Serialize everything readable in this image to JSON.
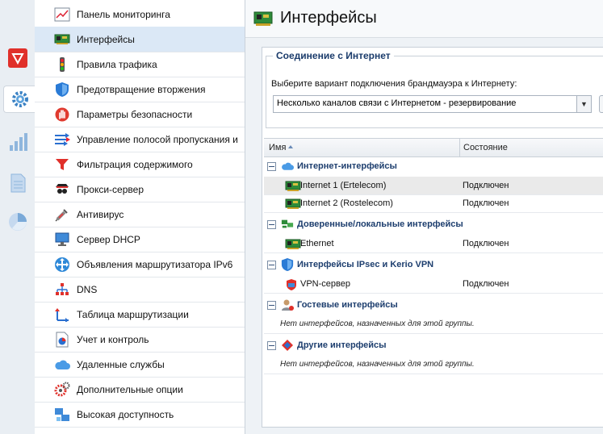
{
  "page": {
    "title": "Интерфейсы"
  },
  "rail": [
    {
      "name": "security-shield-icon",
      "active": false
    },
    {
      "name": "settings-gear-icon",
      "active": true
    },
    {
      "name": "statistics-bars-icon",
      "active": false
    },
    {
      "name": "logs-document-icon",
      "active": false
    },
    {
      "name": "status-pie-icon",
      "active": false
    }
  ],
  "menu": {
    "items": [
      {
        "label": "Панель мониторинга",
        "icon": "dashboard-icon"
      },
      {
        "label": "Интерфейсы",
        "icon": "network-card-icon"
      },
      {
        "label": "Правила трафика",
        "icon": "traffic-light-icon"
      },
      {
        "label": "Предотвращение вторжения",
        "icon": "shield-icon"
      },
      {
        "label": "Параметры безопасности",
        "icon": "hand-stop-icon"
      },
      {
        "label": "Управление полосой пропускания и",
        "icon": "bandwidth-arrows-icon"
      },
      {
        "label": "Фильтрация содержимого",
        "icon": "filter-funnel-icon"
      },
      {
        "label": "Прокси-сервер",
        "icon": "proxy-spy-icon"
      },
      {
        "label": "Антивирус",
        "icon": "syringe-icon"
      },
      {
        "label": "Сервер DHCP",
        "icon": "monitor-network-icon"
      },
      {
        "label": "Объявления маршрутизатора IPv6",
        "icon": "router-arrows-icon"
      },
      {
        "label": "DNS",
        "icon": "dns-tree-icon"
      },
      {
        "label": "Таблица маршрутизации",
        "icon": "routing-arrows-icon"
      },
      {
        "label": "Учет и контроль",
        "icon": "report-pie-icon"
      },
      {
        "label": "Удаленные службы",
        "icon": "cloud-icon"
      },
      {
        "label": "Дополнительные опции",
        "icon": "gears-icon"
      },
      {
        "label": "Высокая доступность",
        "icon": "servers-icon"
      }
    ],
    "active_index": 1
  },
  "internet": {
    "legend": "Соединение с Интернет",
    "description": "Выберите вариант подключения брандмауэра к Интернету:",
    "mode": "Несколько каналов связи с Интернетом - резервирование"
  },
  "grid": {
    "columns": {
      "name": "Имя",
      "state": "Состояние"
    },
    "groups": [
      {
        "title": "Интернет-интерфейсы",
        "icon": "cloud-icon",
        "rows": [
          {
            "name": "Internet 1 (Ertelecom)",
            "state": "Подключен",
            "icon": "network-card-icon",
            "selected": true
          },
          {
            "name": "Internet 2 (Rostelecom)",
            "state": "Подключен",
            "icon": "network-card-icon",
            "selected": false
          }
        ]
      },
      {
        "title": "Доверенные/локальные интерфейсы",
        "icon": "lan-computers-icon",
        "rows": [
          {
            "name": "Ethernet",
            "state": "Подключен",
            "icon": "network-card-icon",
            "selected": false
          }
        ]
      },
      {
        "title": "Интерфейсы IPsec и Kerio VPN",
        "icon": "shield-icon",
        "rows": [
          {
            "name": "VPN-сервер",
            "state": "Подключен",
            "icon": "vpn-server-icon",
            "selected": false
          }
        ]
      },
      {
        "title": "Гостевые интерфейсы",
        "icon": "guest-user-icon",
        "empty": "Нет интерфейсов, назначенных для этой группы."
      },
      {
        "title": "Другие интерфейсы",
        "icon": "other-diamond-icon",
        "empty": "Нет интерфейсов, назначенных для этой группы."
      }
    ]
  },
  "colors": {
    "accent": "#1d3e6e",
    "selected_menu": "#dbe8f6",
    "brand_red": "#e0302a"
  }
}
